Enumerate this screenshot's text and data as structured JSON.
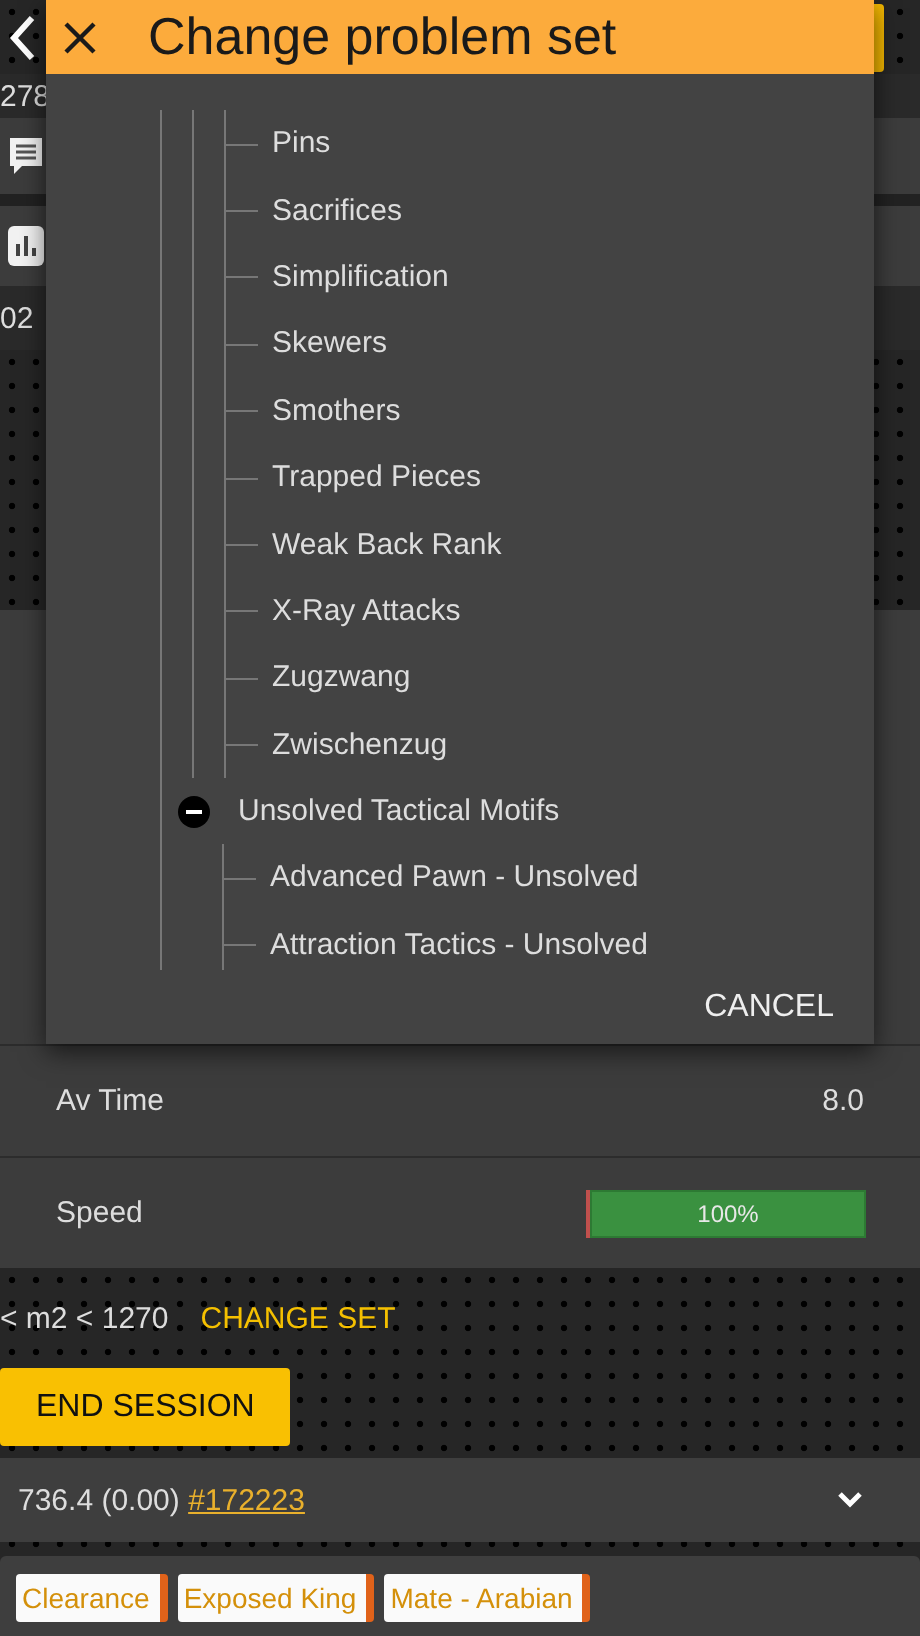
{
  "behind": {
    "count": "278",
    "time": "02"
  },
  "dialog": {
    "title": "Change problem set",
    "tree": [
      {
        "children": [
          {
            "label": "Pins"
          },
          {
            "label": "Sacrifices"
          },
          {
            "label": "Simplification"
          },
          {
            "label": "Skewers"
          },
          {
            "label": "Smothers"
          },
          {
            "label": "Trapped Pieces"
          },
          {
            "label": "Weak Back Rank"
          },
          {
            "label": "X-Ray Attacks"
          },
          {
            "label": "Zugzwang"
          },
          {
            "label": "Zwischenzug"
          }
        ]
      },
      {
        "label": "Unsolved Tactical Motifs",
        "expanded": true,
        "children": [
          {
            "label": "Advanced Pawn - Unsolved"
          },
          {
            "label": "Attraction Tactics - Unsolved"
          }
        ]
      }
    ],
    "cancel": "CANCEL"
  },
  "stats": [
    {
      "kind": "text",
      "label": "Av Time",
      "value": "8.0"
    },
    {
      "kind": "bar",
      "label": "Speed",
      "level": 1,
      "reading": "100%"
    }
  ],
  "filter": {
    "range": "< m2 < 1270",
    "change_set": "CHANGE SET"
  },
  "end_session": "END SESSION",
  "result": {
    "score": "736.4 (0.00)",
    "link": "#172223"
  },
  "tags": [
    "Clearance",
    "Exposed King",
    "Mate - Arabian"
  ]
}
